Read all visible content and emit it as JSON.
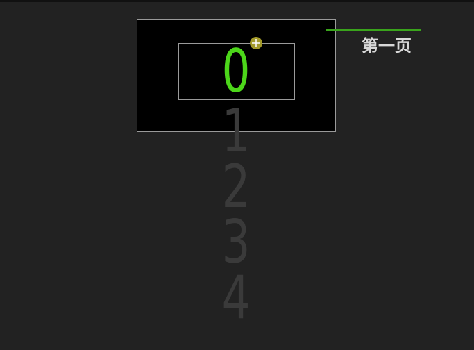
{
  "picker": {
    "current_value": "0",
    "upcoming_values": [
      "1",
      "2",
      "3",
      "4"
    ]
  },
  "callout": {
    "label": "第一页"
  },
  "colors": {
    "background": "#222222",
    "frame": "#000000",
    "active_digit": "#4cd61a",
    "inactive_digit": "#3a3a3a",
    "handle": "#a39a2a",
    "callout_line": "#3aa41c"
  },
  "icons": {
    "handle": "move-crosshair-icon"
  }
}
